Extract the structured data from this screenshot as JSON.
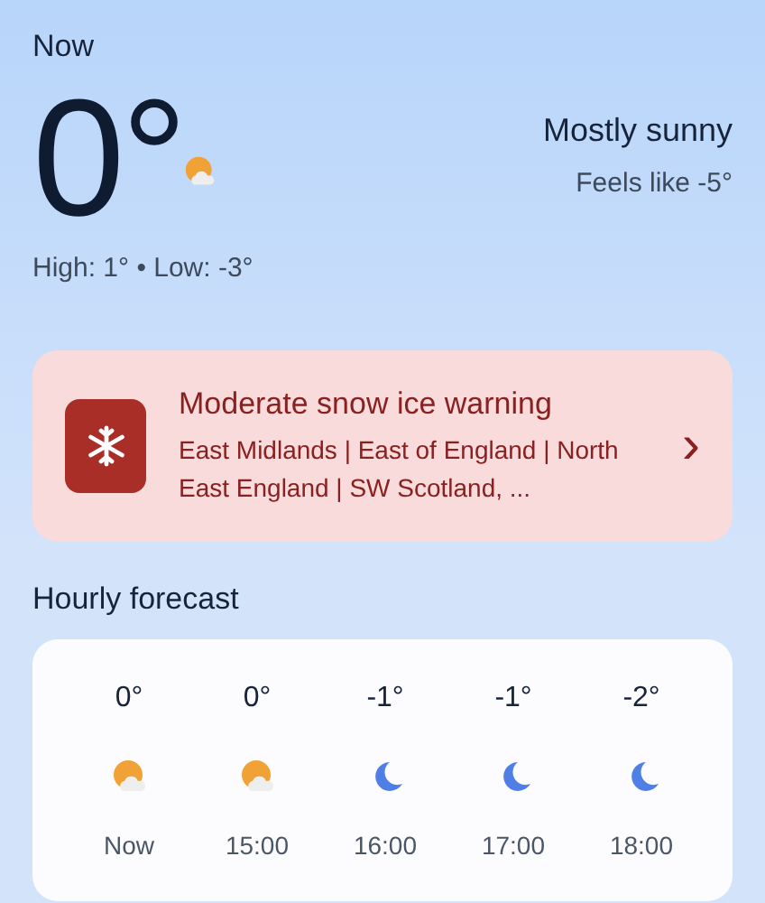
{
  "current": {
    "heading": "Now",
    "temperature": "0°",
    "condition": "Mostly sunny",
    "feels_like": "Feels like -5°",
    "high_low": "High: 1° • Low: -3°"
  },
  "alert": {
    "title": "Moderate snow ice warning",
    "regions": "East Midlands | East of England | North East England | SW Scotland, ...",
    "chevron": "›"
  },
  "hourly": {
    "heading": "Hourly forecast",
    "hours": [
      {
        "temp": "0°",
        "kind": "day",
        "time": "Now"
      },
      {
        "temp": "0°",
        "kind": "day",
        "time": "15:00"
      },
      {
        "temp": "-1°",
        "kind": "night",
        "time": "16:00"
      },
      {
        "temp": "-1°",
        "kind": "night",
        "time": "17:00"
      },
      {
        "temp": "-2°",
        "kind": "night",
        "time": "18:00"
      }
    ]
  }
}
